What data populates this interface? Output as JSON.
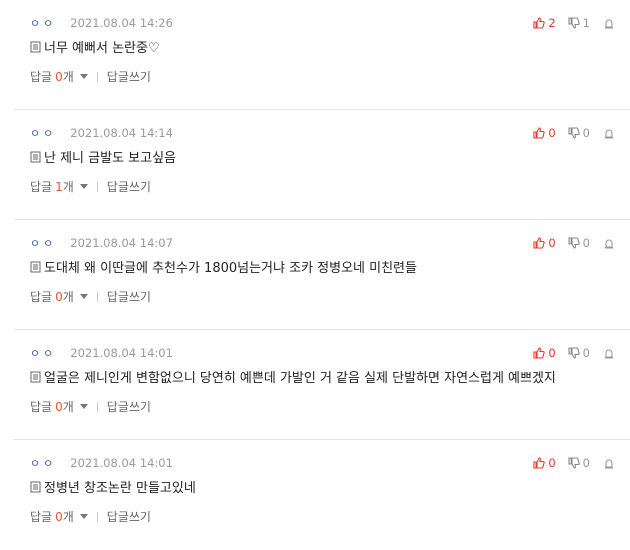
{
  "comments": [
    {
      "nick": "ㅇㅇ",
      "date": "2021.08.04 14:26",
      "text": "너무 예뻐서 논란중♡",
      "up": "2",
      "down": "1",
      "reply_label": "답글",
      "reply_count": "0",
      "reply_unit": "개",
      "write_label": "답글쓰기"
    },
    {
      "nick": "ㅇㅇ",
      "date": "2021.08.04 14:14",
      "text": "난 제니 금발도 보고싶음",
      "up": "0",
      "down": "0",
      "reply_label": "답글",
      "reply_count": "1",
      "reply_unit": "개",
      "write_label": "답글쓰기"
    },
    {
      "nick": "ㅇㅇ",
      "date": "2021.08.04 14:07",
      "text": "도대체 왜 이딴글에 추천수가 1800넘는거냐 조카 정병오네 미친련들",
      "up": "0",
      "down": "0",
      "reply_label": "답글",
      "reply_count": "0",
      "reply_unit": "개",
      "write_label": "답글쓰기"
    },
    {
      "nick": "ㅇㅇ",
      "date": "2021.08.04 14:01",
      "text": "얼굴은 제니인게 변함없으니 당연히 예쁜데 가발인 거 같음 실제 단발하면 자연스럽게 예쁘겠지",
      "up": "0",
      "down": "0",
      "reply_label": "답글",
      "reply_count": "0",
      "reply_unit": "개",
      "write_label": "답글쓰기"
    },
    {
      "nick": "ㅇㅇ",
      "date": "2021.08.04 14:01",
      "text": "정병년 창조논란 만들고있네",
      "up": "0",
      "down": "0",
      "reply_label": "답글",
      "reply_count": "0",
      "reply_unit": "개",
      "write_label": "답글쓰기"
    }
  ],
  "icons": {
    "up": "thumbs-up-icon",
    "down": "thumbs-down-icon",
    "report": "report-siren-icon",
    "doc": "document-icon",
    "caret": "caret-down-icon"
  },
  "colors": {
    "up_count": "#e43a2f",
    "down_count": "#999999",
    "reply_count": "#e4572e",
    "nick": "#3b5bb5",
    "divider": "#e3e3e3"
  }
}
